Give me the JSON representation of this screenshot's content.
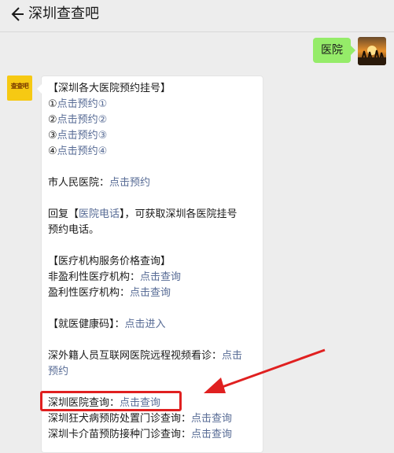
{
  "header": {
    "title": "深圳查查吧"
  },
  "me": {
    "message": "医院"
  },
  "bot": {
    "avatar_text": "查查吧",
    "sections": {
      "s1_title": "【深圳各大医院预约挂号】",
      "s1_items": [
        {
          "num": "①",
          "link": "点击预约①"
        },
        {
          "num": "②",
          "link": "点击预约②"
        },
        {
          "num": "③",
          "link": "点击预约③"
        },
        {
          "num": "④",
          "link": "点击预约④"
        }
      ],
      "city_label": "市人民医院：",
      "city_link": "点击预约",
      "reply_prefix": "回复【",
      "reply_link": "医院电话",
      "reply_suffix": "】，可获取深圳各医院挂号",
      "reply_line2": "预约电话。",
      "price_title": "【医疗机构服务价格查询】",
      "nonprofit_label": "非盈利性医疗机构：",
      "nonprofit_link": "点击查询",
      "profit_label": "盈利性医疗机构：",
      "profit_link": "点击查询",
      "health_title": "【就医健康码】：",
      "health_link": "点击进入",
      "foreign_label": "深外籍人员互联网医院远程视频看诊：",
      "foreign_link_a": "点击",
      "foreign_link_b": "预约",
      "hospital_label": "深圳医院查询：",
      "hospital_link": "点击查询",
      "rabies_label": "深圳狂犬病预防处置门诊查询：",
      "rabies_link": "点击查询",
      "bcg_label": "深圳卡介苗预防接种门诊查询：",
      "bcg_link": "点击查询"
    }
  },
  "colors": {
    "link": "#576b95",
    "my_bubble": "#95ec69",
    "highlight": "#e02020"
  },
  "icons": {
    "back": "back-arrow-icon"
  }
}
